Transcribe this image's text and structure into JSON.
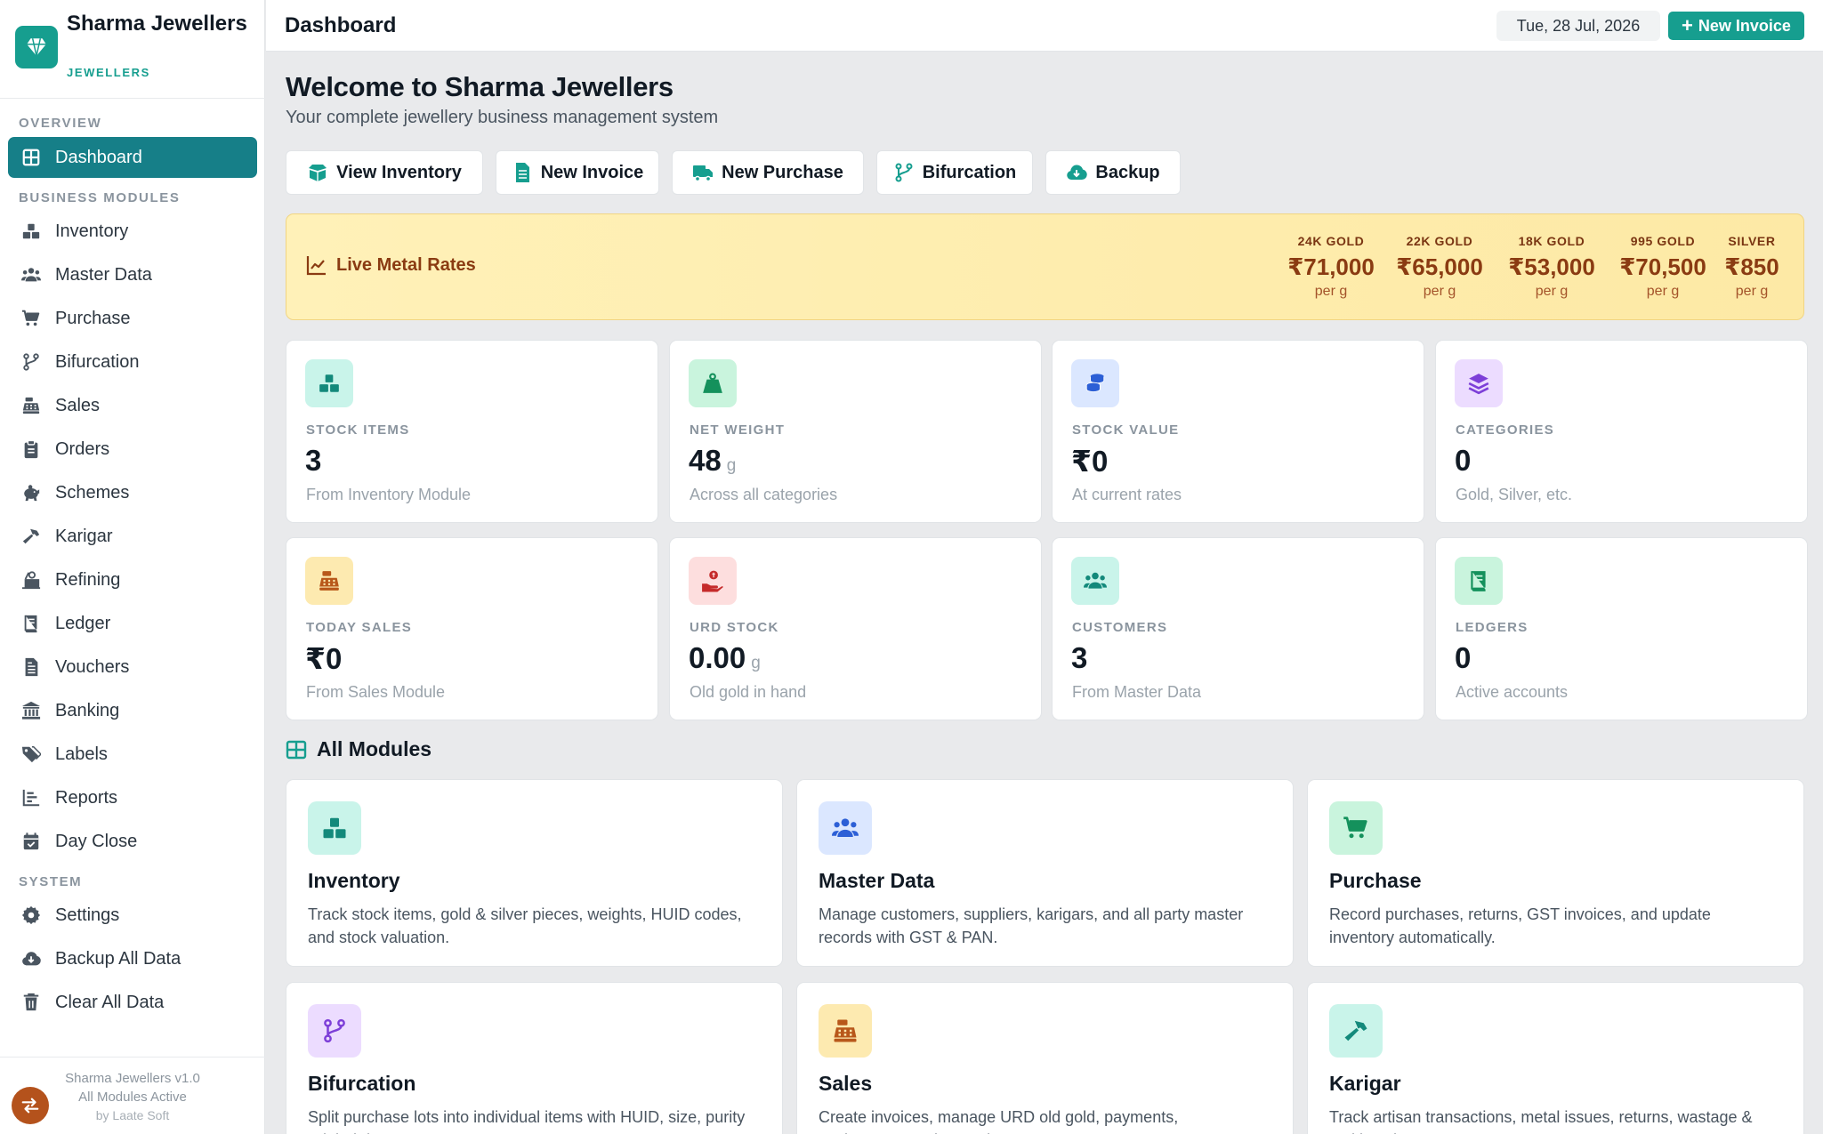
{
  "app": {
    "brand_name": "Sharma Jewellers",
    "brand_subtitle": "JEWELLERS"
  },
  "sidebar": {
    "sections": {
      "overview": "OVERVIEW",
      "business": "BUSINESS MODULES",
      "system": "SYSTEM"
    },
    "items": [
      {
        "label": "Dashboard",
        "icon": "grid-icon",
        "active": true
      },
      {
        "label": "Inventory",
        "icon": "boxes-icon"
      },
      {
        "label": "Master Data",
        "icon": "users-icon"
      },
      {
        "label": "Purchase",
        "icon": "cart-icon"
      },
      {
        "label": "Bifurcation",
        "icon": "branch-icon"
      },
      {
        "label": "Sales",
        "icon": "cash-register-icon"
      },
      {
        "label": "Orders",
        "icon": "clipboard-icon"
      },
      {
        "label": "Schemes",
        "icon": "piggy-bank-icon"
      },
      {
        "label": "Karigar",
        "icon": "hammer-icon"
      },
      {
        "label": "Refining",
        "icon": "scale-icon"
      },
      {
        "label": "Ledger",
        "icon": "book-icon"
      },
      {
        "label": "Vouchers",
        "icon": "file-invoice-icon"
      },
      {
        "label": "Banking",
        "icon": "bank-icon"
      },
      {
        "label": "Labels",
        "icon": "tags-icon"
      },
      {
        "label": "Reports",
        "icon": "chart-icon"
      },
      {
        "label": "Day Close",
        "icon": "calendar-check-icon"
      }
    ],
    "system_items": [
      {
        "label": "Settings",
        "icon": "gear-icon"
      },
      {
        "label": "Backup All Data",
        "icon": "cloud-download-icon"
      },
      {
        "label": "Clear All Data",
        "icon": "trash-icon"
      }
    ],
    "footer": {
      "version": "Sharma Jewellers v1.0",
      "status": "All Modules Active",
      "credit": "by Laate Soft"
    }
  },
  "header": {
    "title": "Dashboard",
    "date": "Tue, 28 Jul, 2026",
    "new_invoice_label": "New Invoice"
  },
  "welcome": {
    "title": "Welcome to Sharma Jewellers",
    "subtitle": "Your complete jewellery business management system"
  },
  "quick_actions": [
    {
      "label": "View Inventory",
      "icon": "box-open-icon"
    },
    {
      "label": "New Invoice",
      "icon": "file-icon"
    },
    {
      "label": "New Purchase",
      "icon": "truck-icon"
    },
    {
      "label": "Bifurcation",
      "icon": "branch-icon"
    },
    {
      "label": "Backup",
      "icon": "cloud-download-icon"
    }
  ],
  "metal_rates": {
    "title": "Live Metal Rates",
    "rates": [
      {
        "label": "24K GOLD",
        "value": "₹71,000",
        "unit": "per g"
      },
      {
        "label": "22K GOLD",
        "value": "₹65,000",
        "unit": "per g"
      },
      {
        "label": "18K GOLD",
        "value": "₹53,000",
        "unit": "per g"
      },
      {
        "label": "995 GOLD",
        "value": "₹70,500",
        "unit": "per g"
      },
      {
        "label": "SILVER",
        "value": "₹850",
        "unit": "per g"
      }
    ]
  },
  "stats": [
    {
      "label": "STOCK ITEMS",
      "value": "3",
      "unit": "",
      "note": "From Inventory Module",
      "icon": "boxes-icon",
      "bg": "#c9f4ea",
      "fg": "#13897b"
    },
    {
      "label": "NET WEIGHT",
      "value": "48",
      "unit": "g",
      "note": "Across all categories",
      "icon": "weight-icon",
      "bg": "#c9f4dd",
      "fg": "#14915c"
    },
    {
      "label": "STOCK VALUE",
      "value": "₹0",
      "unit": "",
      "note": "At current rates",
      "icon": "coins-icon",
      "bg": "#dbe7ff",
      "fg": "#2c5fd6"
    },
    {
      "label": "CATEGORIES",
      "value": "0",
      "unit": "",
      "note": "Gold, Silver, etc.",
      "icon": "layers-icon",
      "bg": "#ecdcff",
      "fg": "#7d3fd8"
    },
    {
      "label": "TODAY SALES",
      "value": "₹0",
      "unit": "",
      "note": "From Sales Module",
      "icon": "cash-register-icon",
      "bg": "#fdeab0",
      "fg": "#b8581a"
    },
    {
      "label": "URD STOCK",
      "value": "0.00",
      "unit": "g",
      "note": "Old gold in hand",
      "icon": "hand-coin-icon",
      "bg": "#fddede",
      "fg": "#c52b2b"
    },
    {
      "label": "CUSTOMERS",
      "value": "3",
      "unit": "",
      "note": "From Master Data",
      "icon": "users-icon",
      "bg": "#c9f4ea",
      "fg": "#13897b"
    },
    {
      "label": "LEDGERS",
      "value": "0",
      "unit": "",
      "note": "Active accounts",
      "icon": "book-icon",
      "bg": "#c9f4dd",
      "fg": "#14915c"
    }
  ],
  "modules": {
    "title": "All Modules",
    "items": [
      {
        "title": "Inventory",
        "desc": "Track stock items, gold & silver pieces, weights, HUID codes, and stock valuation.",
        "icon": "boxes-icon",
        "bg": "#c9f4ea",
        "fg": "#13897b"
      },
      {
        "title": "Master Data",
        "desc": "Manage customers, suppliers, karigars, and all party master records with GST & PAN.",
        "icon": "users-icon",
        "bg": "#dbe7ff",
        "fg": "#2c5fd6"
      },
      {
        "title": "Purchase",
        "desc": "Record purchases, returns, GST invoices, and update inventory automatically.",
        "icon": "cart-icon",
        "bg": "#c9f4dd",
        "fg": "#14915c"
      },
      {
        "title": "Bifurcation",
        "desc": "Split purchase lots into individual items with HUID, size, purity & label data.",
        "icon": "branch-icon",
        "bg": "#ecdcff",
        "fg": "#7d3fd8"
      },
      {
        "title": "Sales",
        "desc": "Create invoices, manage URD old gold, payments, settlements & print receipts.",
        "icon": "cash-register-icon",
        "bg": "#fdeab0",
        "fg": "#b8581a"
      },
      {
        "title": "Karigar",
        "desc": "Track artisan transactions, metal issues, returns, wastage & making charges.",
        "icon": "hammer-icon",
        "bg": "#c9f4ea",
        "fg": "#13897b"
      }
    ]
  },
  "colors": {
    "accent": "#169e8f",
    "active_nav": "#167f88",
    "rates_text": "#8a3b12"
  }
}
